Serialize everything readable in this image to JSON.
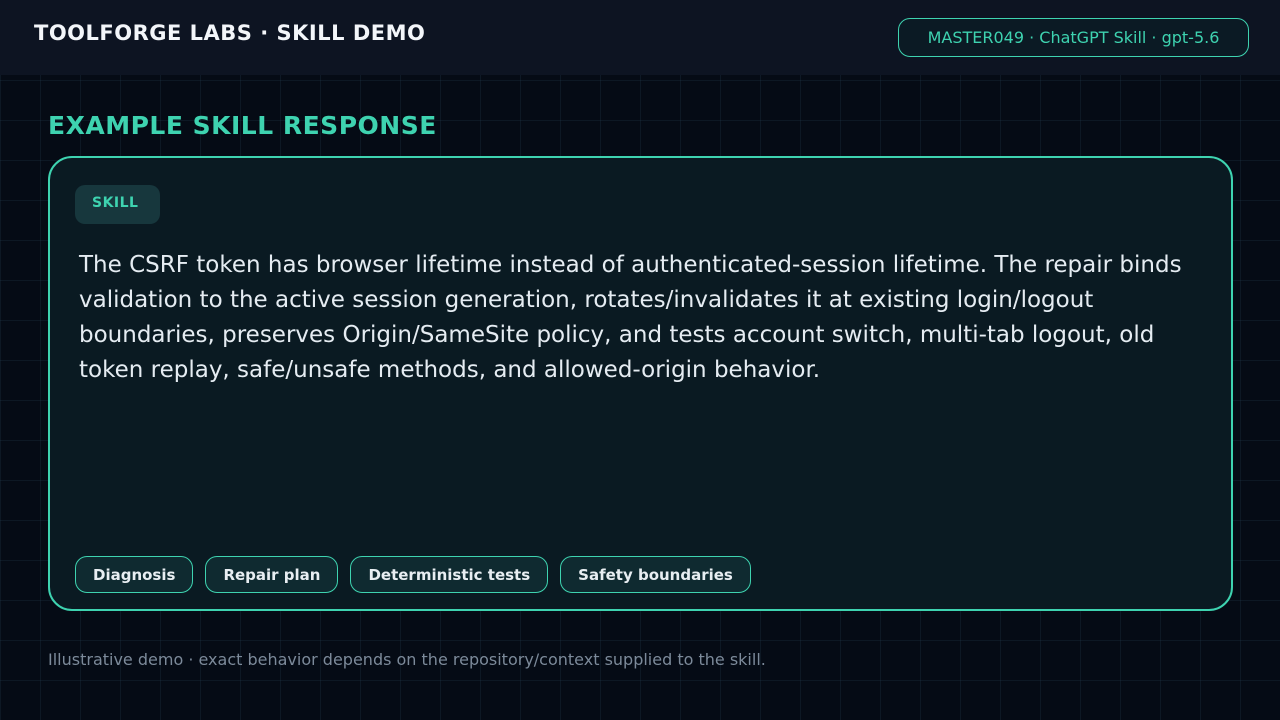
{
  "header": {
    "brand": "TOOLFORGE LABS · SKILL DEMO",
    "meta": "MASTER049 · ChatGPT Skill · gpt-5.6"
  },
  "main": {
    "title": "EXAMPLE SKILL RESPONSE",
    "card": {
      "badge": "SKILL",
      "response": "The CSRF token has browser lifetime instead of authenticated-session lifetime. The repair binds validation to the active session generation, rotates/invalidates it at existing login/logout boundaries, preserves Origin/SameSite policy, and tests account switch, multi-tab logout, old token replay, safe/unsafe methods, and allowed-origin behavior.",
      "tags": [
        "Diagnosis",
        "Repair plan",
        "Deterministic tests",
        "Safety boundaries"
      ]
    }
  },
  "footer": {
    "note": "Illustrative demo · exact behavior depends on the repository/context supplied to the skill."
  },
  "colors": {
    "accent": "#3ed3b0",
    "background": "#050b15",
    "card": "#0a1a22"
  }
}
